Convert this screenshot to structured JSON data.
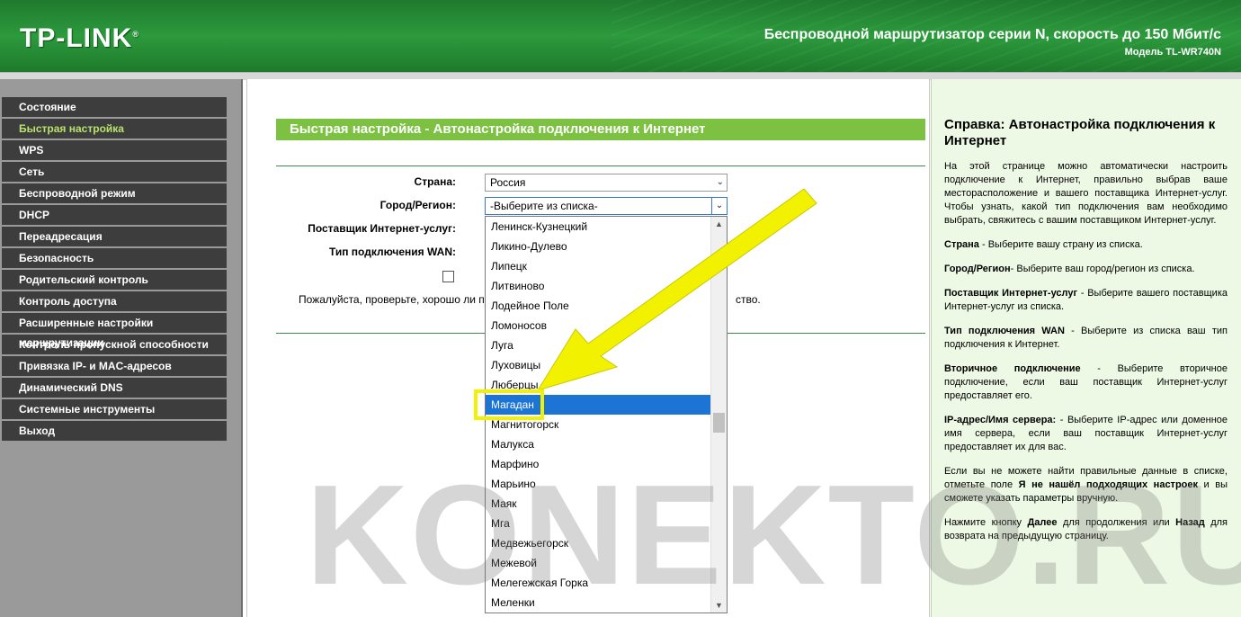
{
  "header": {
    "logo": "TP-LINK",
    "title": "Беспроводной маршрутизатор серии N, скорость до 150 Мбит/с",
    "model": "Модель TL-WR740N"
  },
  "sidebar": {
    "items": [
      {
        "label": "Состояние"
      },
      {
        "label": "Быстрая настройка"
      },
      {
        "label": "WPS"
      },
      {
        "label": "Сеть"
      },
      {
        "label": "Беспроводной режим"
      },
      {
        "label": "DHCP"
      },
      {
        "label": "Переадресация"
      },
      {
        "label": "Безопасность"
      },
      {
        "label": "Родительский контроль"
      },
      {
        "label": "Контроль доступа"
      },
      {
        "label": "Расширенные настройки маршрутизации"
      },
      {
        "label": "Контроль пропускной способности"
      },
      {
        "label": "Привязка IP- и MAC-адресов"
      },
      {
        "label": "Динамический DNS"
      },
      {
        "label": "Системные инструменты"
      },
      {
        "label": "Выход"
      }
    ],
    "active_index": 1
  },
  "main": {
    "title": "Быстрая настройка - Автонастройка подключения к Интернет",
    "country_label": "Страна:",
    "country_value": "Россия",
    "region_label": "Город/Регион:",
    "region_value": "-Выберите из списка-",
    "isp_label": "Поставщик Интернет-услуг:",
    "wan_label": "Тип подключения WAN:",
    "note_start": "Пожалуйста, проверьте, хорошо ли п",
    "note_end": "ство."
  },
  "dropdown": {
    "items": [
      "Ленинск-Кузнецкий",
      "Ликино-Дулево",
      "Липецк",
      "Литвиново",
      "Лодейное Поле",
      "Ломоносов",
      "Луга",
      "Луховицы",
      "Люберцы",
      "Магадан",
      "Магнитогорск",
      "Малукса",
      "Марфино",
      "Марьино",
      "Маяк",
      "Мга",
      "Медвежьегорск",
      "Межевой",
      "Мелегежская Горка",
      "Меленки"
    ],
    "selected": "Магадан"
  },
  "help": {
    "title": "Справка: Автонастройка подключения к Интернет",
    "intro": "На этой странице можно автоматически настроить подключение к Интернет, правильно выбрав ваше месторасположение и вашего поставщика Интернет-услуг. Чтобы узнать, какой тип подключения вам необходимо выбрать, свяжитесь с вашим поставщиком Интернет-услуг.",
    "country_term": "Страна",
    "country_desc": " - Выберите вашу страну из списка.",
    "region_term": "Город/Регион",
    "region_desc": "- Выберите ваш город/регион из списка.",
    "isp_term": "Поставщик Интернет-услуг",
    "isp_desc": " - Выберите вашего поставщика Интернет-услуг из списка.",
    "wan_term": "Тип подключения WAN",
    "wan_desc": " - Выберите из списка ваш тип подключения к Интернет.",
    "secondary_term": "Вторичное подключение",
    "secondary_desc": " - Выберите вторичное подключение, если ваш поставщик Интернет-услуг предоставляет его.",
    "server_term": "IP-адрес/Имя сервера:",
    "server_desc": " - Выберите IP-адрес или доменное имя сервера, если ваш поставщик Интернет-услуг предоставляет их для вас.",
    "notfound_pre": "Если вы не можете найти правильные данные в списке, отметьте поле ",
    "notfound_term": "Я не нашёл подходящих настроек",
    "notfound_post": " и вы сможете указать параметры вручную.",
    "nav_pre": "Нажмите кнопку ",
    "nav_next": "Далее",
    "nav_mid": " для продолжения или ",
    "nav_back": "Назад",
    "nav_post": " для возврата на предыдущую страницу."
  },
  "watermark": "KONEKTO.RU",
  "colors": {
    "header_green": "#2c9a3d",
    "title_bar_green": "#7dc142",
    "menu_bg": "#3d3d3d",
    "menu_active_text": "#b9e26a",
    "selection_blue": "#1c74d4",
    "annotation_yellow": "#f2f200",
    "help_bg": "#eef9e5"
  }
}
